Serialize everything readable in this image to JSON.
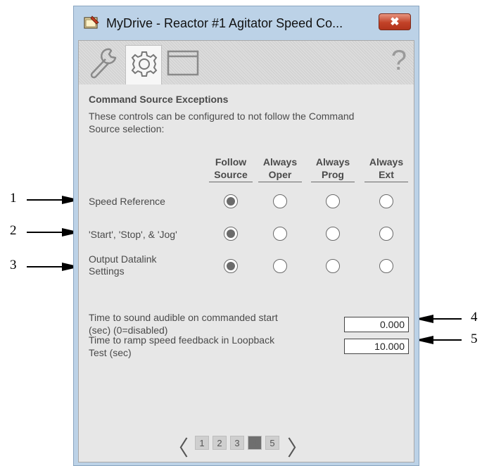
{
  "window": {
    "title": "MyDrive - Reactor #1 Agitator Speed Co...",
    "close_label": "✖"
  },
  "toolbar": {
    "tabs": [
      {
        "name": "maintenance-tab",
        "icon": "wrench-icon"
      },
      {
        "name": "configuration-tab",
        "icon": "gear-icon",
        "selected": true
      },
      {
        "name": "faceplate-tab",
        "icon": "window-icon"
      }
    ],
    "help_label": "?"
  },
  "section": {
    "title": "Command Source Exceptions",
    "description": "These controls can be configured to not follow the Command Source selection:"
  },
  "columns": [
    {
      "line1": "Follow",
      "line2": "Source"
    },
    {
      "line1": "Always",
      "line2": "Oper"
    },
    {
      "line1": "Always",
      "line2": "Prog"
    },
    {
      "line1": "Always",
      "line2": "Ext"
    }
  ],
  "rows": [
    {
      "label_line1": "Speed Reference",
      "label_line2": "",
      "selected": 0
    },
    {
      "label_line1": "'Start', 'Stop', & 'Jog'",
      "label_line2": "",
      "selected": 0
    },
    {
      "label_line1": "Output Datalink",
      "label_line2": "Settings",
      "selected": 0
    }
  ],
  "fields": [
    {
      "label_line1": "Time to sound audible on commanded start",
      "label_line2": "(sec) (0=disabled)",
      "value": "0.000"
    },
    {
      "label_line1": "Time to ramp speed feedback in Loopback",
      "label_line2": "Test (sec)",
      "value": "10.000"
    }
  ],
  "pager": {
    "prev": "〈",
    "next": "〉",
    "pages": [
      "1",
      "2",
      "3",
      "4",
      "5"
    ],
    "current": "4"
  },
  "callouts": [
    "1",
    "2",
    "3",
    "4",
    "5"
  ]
}
